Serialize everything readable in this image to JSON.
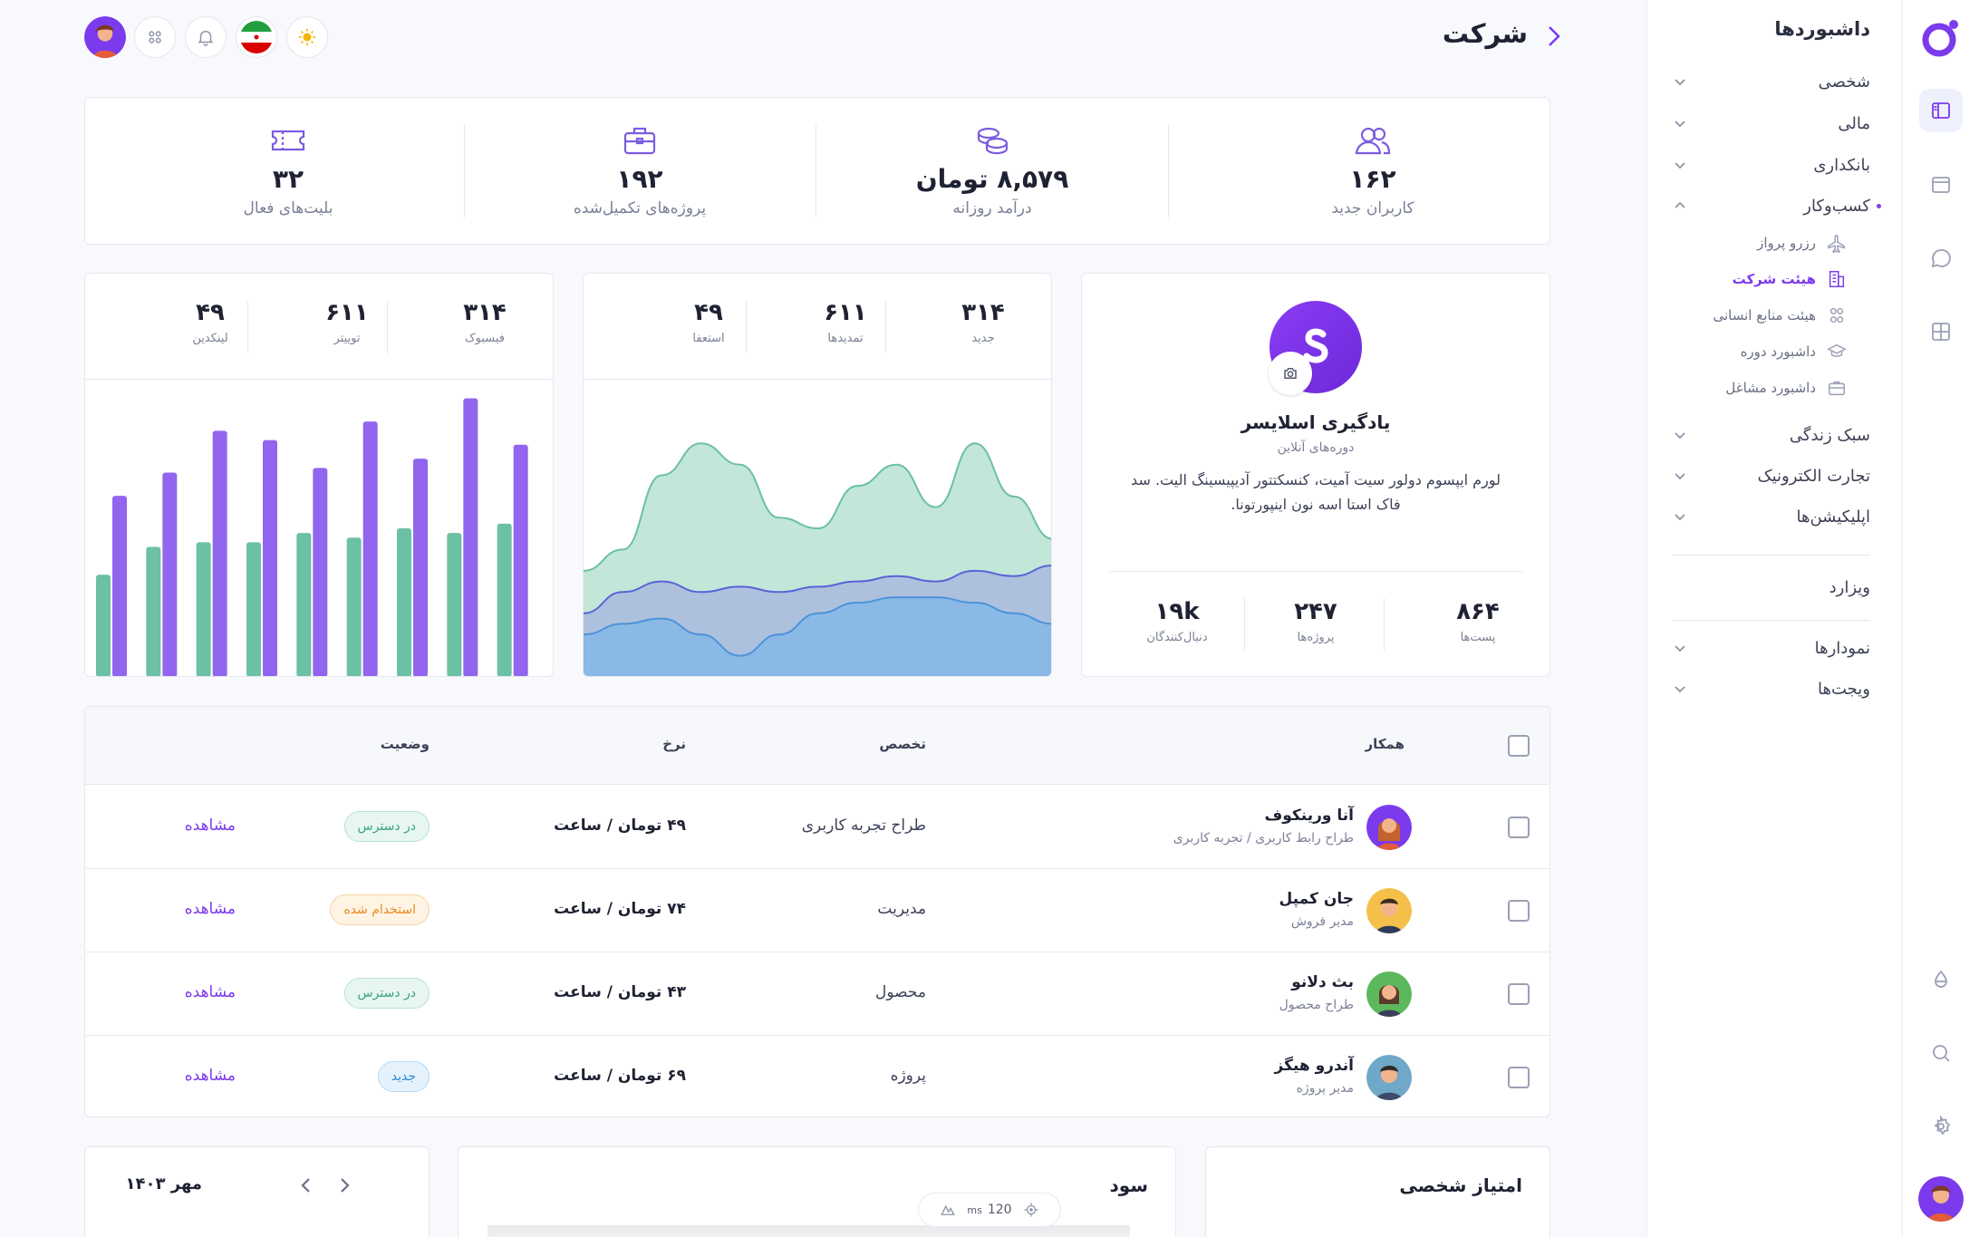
{
  "header": {
    "title": "شرکت"
  },
  "sidebar": {
    "title": "داشبوردها",
    "items": [
      {
        "label": "شخصی"
      },
      {
        "label": "مالی"
      },
      {
        "label": "بانکداری"
      },
      {
        "label": "کسب‌وکار"
      },
      {
        "label": "سبک زندگی"
      },
      {
        "label": "تجارت الکترونیک"
      },
      {
        "label": "اپلیکیشن‌ها"
      },
      {
        "label": "ویزارد"
      },
      {
        "label": "نمودارها"
      },
      {
        "label": "ویجت‌ها"
      }
    ],
    "business_sub": [
      {
        "label": "رزرو پرواز"
      },
      {
        "label": "هیئت شرکت"
      },
      {
        "label": "هیئت منابع انسانی"
      },
      {
        "label": "داشبورد دوره"
      },
      {
        "label": "داشبورد مشاغل"
      }
    ]
  },
  "stats": [
    {
      "value": "۱۶۲",
      "label": "کاربران جدید",
      "icon": "users-icon"
    },
    {
      "value": "۸,۵۷۹ تومان",
      "label": "درآمد روزانه",
      "icon": "coins-icon"
    },
    {
      "value": "۱۹۲",
      "label": "پروژه‌های تکمیل‌شده",
      "icon": "briefcase-icon"
    },
    {
      "value": "۳۲",
      "label": "بلیت‌های فعال",
      "icon": "ticket-icon"
    }
  ],
  "profile": {
    "name": "یادگیری اسلایسر",
    "subtitle": "دوره‌های آنلاین",
    "description": "لورم ایپسوم دولور سیت آمیت، کنسکتتور آدیپیسینگ الیت. سد فاک استا اسه نون اینپورتونا.",
    "stats": [
      {
        "value": "۸۶۴",
        "label": "پست‌ها"
      },
      {
        "value": "۲۴۷",
        "label": "پروژه‌ها"
      },
      {
        "value": "۱۹k",
        "label": "دنبال‌کنندگان"
      }
    ]
  },
  "area_card": {
    "stats": [
      {
        "value": "۳۱۴",
        "label": "جدید"
      },
      {
        "value": "۶۱۱",
        "label": "تمدیدها"
      },
      {
        "value": "۴۹",
        "label": "استعفا"
      }
    ],
    "chart_data": {
      "type": "area",
      "series": [
        {
          "values": [
            10,
            12,
            19,
            22,
            20,
            15,
            14,
            18,
            20,
            16,
            22,
            17,
            13
          ],
          "color": "#a8dcc8"
        },
        {
          "values": [
            6,
            8,
            9,
            8,
            8.5,
            8,
            8.5,
            9,
            9.5,
            9,
            10,
            9.5,
            10.5
          ],
          "color": "#9fa8e2"
        },
        {
          "values": [
            4,
            5,
            5.5,
            4,
            2,
            4,
            6,
            7,
            7.5,
            7.5,
            7,
            6,
            5
          ],
          "color": "#7fb6e8"
        }
      ]
    }
  },
  "bar_card": {
    "stats": [
      {
        "value": "۳۱۴",
        "label": "فیسبوک"
      },
      {
        "value": "۶۱۱",
        "label": "توییتر"
      },
      {
        "value": "۴۹",
        "label": "لینکدین"
      }
    ],
    "chart_data": {
      "type": "bar",
      "series": [
        {
          "values": [
            22,
            28,
            29,
            29,
            31,
            30,
            32,
            31,
            33
          ],
          "color": "#6cc0a3"
        },
        {
          "values": [
            39,
            44,
            53,
            51,
            45,
            55,
            47,
            60,
            50
          ],
          "color": "#9165ee"
        }
      ]
    }
  },
  "table": {
    "headers": {
      "member": "همکار",
      "specialty": "تخصص",
      "rate": "نرخ",
      "status": "وضعیت"
    },
    "rows": [
      {
        "name": "آنا ورینکوف",
        "role": "طراح رابط کاربری / تجربه کاربری",
        "specialty": "طراح تجربه کاربری",
        "rate": "۴۹ تومان / ساعت",
        "status": "در دسترس",
        "status_color": "green",
        "action": "مشاهده"
      },
      {
        "name": "جان کمپل",
        "role": "مدیر فروش",
        "specialty": "مدیریت",
        "rate": "۷۴ تومان / ساعت",
        "status": "استخدام شده",
        "status_color": "orange",
        "action": "مشاهده"
      },
      {
        "name": "بث دلانو",
        "role": "طراح محصول",
        "specialty": "محصول",
        "rate": "۴۳ تومان / ساعت",
        "status": "در دسترس",
        "status_color": "green",
        "action": "مشاهده"
      },
      {
        "name": "آندرو هیگز",
        "role": "مدیر پروژه",
        "specialty": "پروژه",
        "rate": "۶۹ تومان / ساعت",
        "status": "جدید",
        "status_color": "blue",
        "action": "مشاهده"
      }
    ]
  },
  "bottom": {
    "personal_score_title": "امتیاز شخصی",
    "profit_title": "سود",
    "fps_value": "120",
    "fps_unit": "ms",
    "calendar_month": "مهر ۱۴۰۳"
  },
  "colors": {
    "accent": "#7c3aed",
    "green": "#6cc0a3",
    "purple": "#9165ee"
  }
}
